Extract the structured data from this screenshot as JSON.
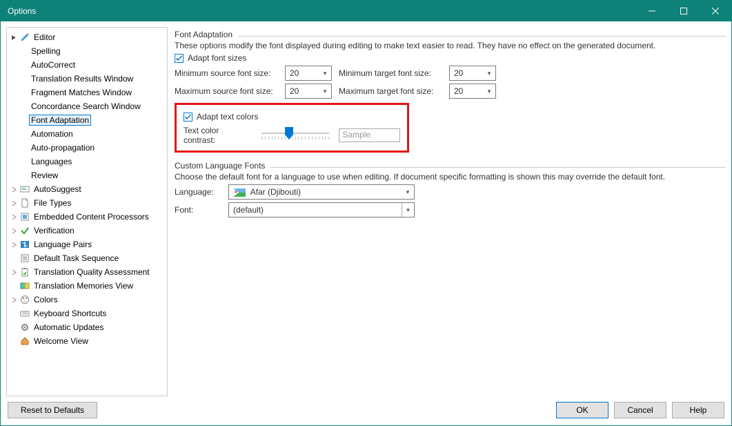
{
  "titlebar": {
    "title": "Options"
  },
  "tree": {
    "editor": {
      "label": "Editor",
      "children": {
        "spelling": "Spelling",
        "autocorrect": "AutoCorrect",
        "transres": "Translation Results Window",
        "fragmatch": "Fragment Matches Window",
        "concord": "Concordance Search Window",
        "fontadapt": "Font Adaptation",
        "automation": "Automation",
        "autoprop": "Auto-propagation",
        "languages": "Languages",
        "review": "Review"
      }
    },
    "autosuggest": "AutoSuggest",
    "filetypes": "File Types",
    "embedded": "Embedded Content Processors",
    "verification": "Verification",
    "langpairs": "Language Pairs",
    "defaulttask": "Default Task Sequence",
    "tqa": "Translation Quality Assessment",
    "tmview": "Translation Memories View",
    "colors": "Colors",
    "keyboard": "Keyboard Shortcuts",
    "autoupdate": "Automatic Updates",
    "welcome": "Welcome View"
  },
  "content": {
    "fontadapt": {
      "title": "Font Adaptation",
      "desc": "These options modify the font displayed during editing to make text easier to read. They have no effect on the generated document.",
      "adaptFontSizes": "Adapt font sizes",
      "minSource": {
        "label": "Minimum source font size:",
        "value": "20"
      },
      "minTarget": {
        "label": "Minimum target font size:",
        "value": "20"
      },
      "maxSource": {
        "label": "Maximum source font size:",
        "value": "20"
      },
      "maxTarget": {
        "label": "Maximum target font size:",
        "value": "20"
      },
      "adaptTextColors": "Adapt text colors",
      "contrastLabel": "Text color contrast:",
      "sample": "Sample"
    },
    "customLang": {
      "title": "Custom Language Fonts",
      "desc": "Choose the default font for a language to use when editing. If document specific formatting is shown this may override the default font.",
      "languageLabel": "Language:",
      "languageValue": "Afar (Djibouti)",
      "fontLabel": "Font:",
      "fontValue": "(default)"
    }
  },
  "footer": {
    "reset": "Reset to Defaults",
    "ok": "OK",
    "cancel": "Cancel",
    "help": "Help"
  }
}
